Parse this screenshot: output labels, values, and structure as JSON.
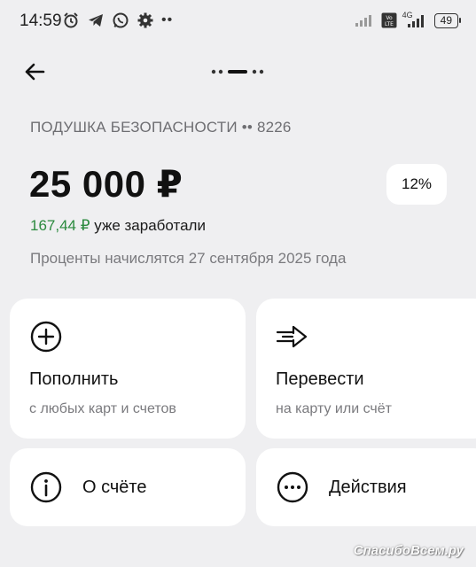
{
  "status_bar": {
    "time": "14:59",
    "network": "4G",
    "volte": "Vo LTE",
    "battery": "49"
  },
  "header": {
    "back_icon": "arrow-left-icon",
    "page_indicator_icon": "page-dots-icon"
  },
  "account": {
    "title": "ПОДУШКА БЕЗОПАСНОСТИ •• 8226",
    "balance": "25 000 ₽",
    "rate": "12%",
    "earned_amount": "167,44 ₽",
    "earned_text": " уже заработали",
    "accrual_note": "Проценты начислятся 27 сентября 2025 года"
  },
  "actions": {
    "top_up": {
      "title": "Пополнить",
      "subtitle": "с любых карт и счетов",
      "icon": "plus-circle-icon"
    },
    "transfer": {
      "title": "Перевести",
      "subtitle": "на карту или счёт",
      "icon": "transfer-arrow-icon"
    },
    "about": {
      "title": "О счёте",
      "icon": "info-icon"
    },
    "more": {
      "title": "Действия",
      "icon": "more-dots-icon"
    }
  },
  "watermark": "СпасибоВсем.ру",
  "colors": {
    "background": "#efeff1",
    "card": "#ffffff",
    "earned": "#2b8a3e"
  }
}
